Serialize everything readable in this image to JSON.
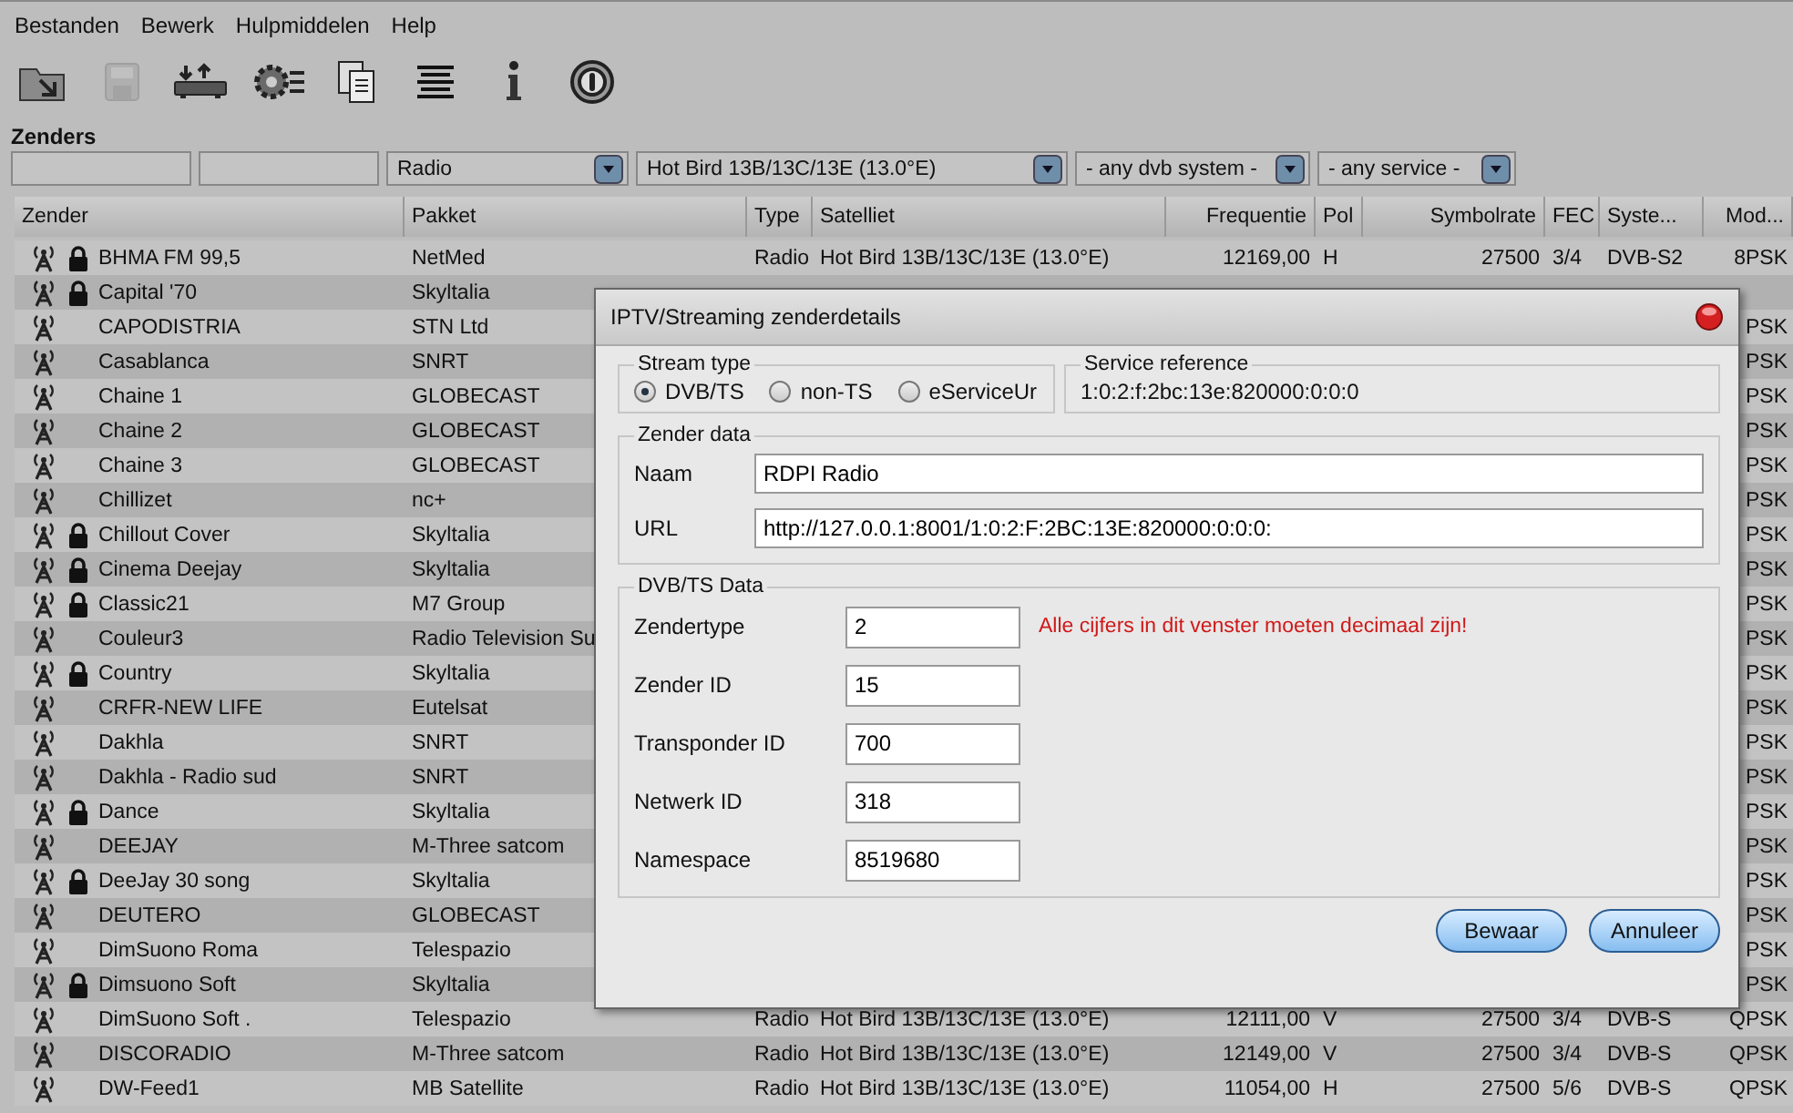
{
  "menu": [
    "Bestanden",
    "Bewerk",
    "Hulpmiddelen",
    "Help"
  ],
  "toolbar": [
    {
      "kind": "open",
      "disabled": false
    },
    {
      "kind": "save",
      "disabled": true
    },
    {
      "kind": "transfer",
      "disabled": false
    },
    {
      "kind": "settings",
      "disabled": false
    },
    {
      "kind": "copy",
      "disabled": false
    },
    {
      "kind": "lines",
      "disabled": false
    },
    {
      "kind": "info",
      "disabled": false
    },
    {
      "kind": "power",
      "disabled": false
    }
  ],
  "section_title": "Zenders",
  "filters": {
    "fields": [
      {
        "kind": "text"
      },
      {
        "kind": "text"
      }
    ],
    "dropdowns": [
      "Radio",
      "Hot Bird 13B/13C/13E (13.0°E)",
      "- any dvb system -",
      "- any service -"
    ]
  },
  "table": {
    "columns": [
      "Zender",
      "Pakket",
      "Type",
      "Satelliet",
      "Frequentie",
      "Pol",
      "Symbolrate",
      "FEC",
      "Syste...",
      "Mod..."
    ],
    "rows": [
      {
        "zender": "BHMA FM 99,5",
        "locked": true,
        "pakket": "NetMed",
        "type": "Radio",
        "satelliet": "Hot Bird 13B/13C/13E (13.0°E)",
        "frequentie": "12169,00",
        "pol": "H",
        "symbolrate": "27500",
        "fec": "3/4",
        "systeem": "DVB-S2",
        "mod": "8PSK"
      },
      {
        "zender": "Capital '70",
        "locked": true,
        "pakket": "Skyltalia"
      },
      {
        "zender": "CAPODISTRIA",
        "locked": false,
        "pakket": "STN Ltd",
        "mod": "PSK"
      },
      {
        "zender": "Casablanca",
        "locked": false,
        "pakket": "SNRT",
        "mod": "PSK"
      },
      {
        "zender": "Chaine 1",
        "locked": false,
        "pakket": "GLOBECAST",
        "mod": "PSK"
      },
      {
        "zender": "Chaine 2",
        "locked": false,
        "pakket": "GLOBECAST",
        "mod": "PSK"
      },
      {
        "zender": "Chaine 3",
        "locked": false,
        "pakket": "GLOBECAST",
        "mod": "PSK"
      },
      {
        "zender": "Chillizet",
        "locked": false,
        "pakket": "nc+",
        "mod": "PSK"
      },
      {
        "zender": "Chillout Cover",
        "locked": true,
        "pakket": "Skyltalia",
        "mod": "PSK"
      },
      {
        "zender": "Cinema Deejay",
        "locked": true,
        "pakket": "Skyltalia",
        "mod": "PSK"
      },
      {
        "zender": "Classic21",
        "locked": true,
        "pakket": "M7 Group",
        "mod": "PSK"
      },
      {
        "zender": "Couleur3",
        "locked": false,
        "pakket": "Radio Television Su",
        "mod": "PSK"
      },
      {
        "zender": "Country",
        "locked": true,
        "pakket": "Skyltalia",
        "mod": "PSK"
      },
      {
        "zender": "CRFR-NEW LIFE",
        "locked": false,
        "pakket": "Eutelsat",
        "mod": "PSK"
      },
      {
        "zender": "Dakhla",
        "locked": false,
        "pakket": "SNRT",
        "mod": "PSK"
      },
      {
        "zender": "Dakhla - Radio sud",
        "locked": false,
        "pakket": "SNRT",
        "mod": "PSK"
      },
      {
        "zender": "Dance",
        "locked": true,
        "pakket": "Skyltalia",
        "mod": "PSK"
      },
      {
        "zender": "DEEJAY",
        "locked": false,
        "pakket": "M-Three satcom",
        "mod": "PSK"
      },
      {
        "zender": "DeeJay 30 song",
        "locked": true,
        "pakket": "Skyltalia",
        "mod": "PSK"
      },
      {
        "zender": "DEUTERO",
        "locked": false,
        "pakket": "GLOBECAST",
        "mod": "PSK"
      },
      {
        "zender": "DimSuono Roma",
        "locked": false,
        "pakket": "Telespazio",
        "mod": "PSK"
      },
      {
        "zender": "Dimsuono Soft",
        "locked": true,
        "pakket": "Skyltalia",
        "mod": "PSK"
      },
      {
        "zender": "DimSuono Soft .",
        "locked": false,
        "pakket": "Telespazio",
        "type": "Radio",
        "satelliet": "Hot Bird 13B/13C/13E (13.0°E)",
        "frequentie": "12111,00",
        "pol": "V",
        "symbolrate": "27500",
        "fec": "3/4",
        "systeem": "DVB-S",
        "mod": "QPSK"
      },
      {
        "zender": "DISCORADIO",
        "locked": false,
        "pakket": "M-Three satcom",
        "type": "Radio",
        "satelliet": "Hot Bird 13B/13C/13E (13.0°E)",
        "frequentie": "12149,00",
        "pol": "V",
        "symbolrate": "27500",
        "fec": "3/4",
        "systeem": "DVB-S",
        "mod": "QPSK"
      },
      {
        "zender": "DW-Feed1",
        "locked": false,
        "pakket": "MB Satellite",
        "type": "Radio",
        "satelliet": "Hot Bird 13B/13C/13E (13.0°E)",
        "frequentie": "11054,00",
        "pol": "H",
        "symbolrate": "27500",
        "fec": "5/6",
        "systeem": "DVB-S",
        "mod": "QPSK"
      }
    ]
  },
  "dialog": {
    "title": "IPTV/Streaming zenderdetails",
    "stream_type": {
      "legend": "Stream type",
      "options": [
        {
          "label": "DVB/TS",
          "selected": true
        },
        {
          "label": "non-TS",
          "selected": false
        },
        {
          "label": "eServiceUr",
          "selected": false
        }
      ]
    },
    "service_reference": {
      "legend": "Service reference",
      "value": "1:0:2:f:2bc:13e:820000:0:0:0"
    },
    "zender_data": {
      "legend": "Zender data",
      "fields": [
        {
          "label": "Naam",
          "value": "RDPI Radio"
        },
        {
          "label": "URL",
          "value": "http://127.0.0.1:8001/1:0:2:F:2BC:13E:820000:0:0:0:"
        }
      ]
    },
    "dvb_data": {
      "legend": "DVB/TS Data",
      "fields": [
        {
          "label": "Zendertype",
          "value": "2"
        },
        {
          "label": "Zender ID",
          "value": "15"
        },
        {
          "label": "Transponder ID",
          "value": "700"
        },
        {
          "label": "Netwerk ID",
          "value": "318"
        },
        {
          "label": "Namespace",
          "value": "8519680"
        }
      ],
      "warning": "Alle cijfers in dit venster moeten decimaal zijn!"
    },
    "buttons": [
      "Bewaar",
      "Annuleer"
    ]
  }
}
